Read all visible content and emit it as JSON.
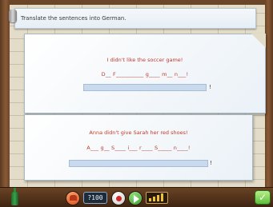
{
  "instruction": {
    "text": "Translate the sentences into German."
  },
  "exercises": [
    {
      "sentence": "I didn't like the soccer game!",
      "hint": "D__ F__________ g____ m__ n___!",
      "answer_value": "",
      "end_punctuation": "!"
    },
    {
      "sentence": "Anna didn't give Sarah her red shoes!",
      "hint": "A___ g__ S____ i___ r____ S_____ n____!",
      "answer_value": "",
      "end_punctuation": "!"
    }
  ],
  "toolbar": {
    "score_display": "?100",
    "icons": [
      "potion-bottle-icon",
      "hat-icon",
      "record-icon",
      "play-icon",
      "level-meter-icon",
      "checkmark-icon"
    ],
    "check_symbol": "✓"
  },
  "colors": {
    "sentence_text": "#c0392b",
    "answer_field": "#c9d9ee",
    "toolbar": "#5a381c",
    "check_button": "#5cbf3a"
  }
}
